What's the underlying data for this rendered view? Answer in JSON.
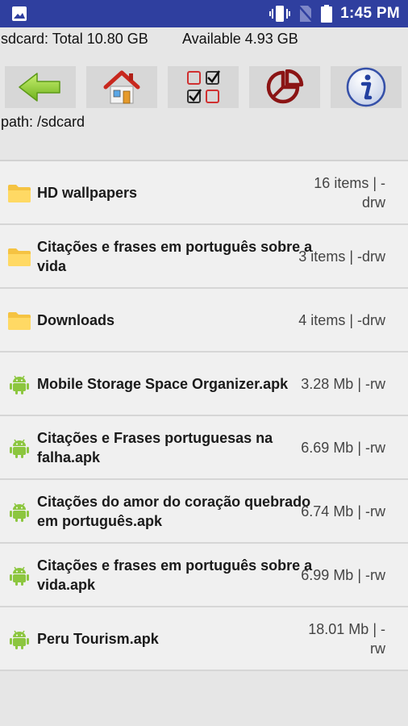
{
  "status_bar": {
    "time": "1:45 PM",
    "icons": [
      "image-icon",
      "vibrate-icon",
      "no-sim-icon",
      "battery-icon"
    ],
    "color": "#2f3f9f"
  },
  "storage": {
    "total": "sdcard: Total 10.80 GB",
    "available": "Available 4.93 GB"
  },
  "toolbar": {
    "buttons": [
      {
        "name": "back",
        "icon": "back-arrow-icon"
      },
      {
        "name": "home",
        "icon": "home-icon"
      },
      {
        "name": "select",
        "icon": "checklist-icon"
      },
      {
        "name": "storage-chart",
        "icon": "pie-chart-icon"
      },
      {
        "name": "info",
        "icon": "info-icon"
      }
    ]
  },
  "path": "path: /sdcard",
  "files": [
    {
      "type": "folder",
      "icon": "folder-icon",
      "name": "HD wallpapers",
      "meta": "16 items | -drw"
    },
    {
      "type": "folder",
      "icon": "folder-icon",
      "name": "Citações e frases em português sobre a vida",
      "meta": "3 items | -drw"
    },
    {
      "type": "folder",
      "icon": "folder-icon",
      "name": "Downloads",
      "meta": "4 items | -drw"
    },
    {
      "type": "apk",
      "icon": "android-icon",
      "name": "Mobile Storage Space Organizer.apk",
      "meta": "3.28 Mb  | -rw"
    },
    {
      "type": "apk",
      "icon": "android-icon",
      "name": "Citações e Frases portuguesas na falha.apk",
      "meta": "6.69 Mb  | -rw"
    },
    {
      "type": "apk",
      "icon": "android-icon",
      "name": "Citações do amor do coração quebrado em português.apk",
      "meta": "6.74 Mb  | -rw"
    },
    {
      "type": "apk",
      "icon": "android-icon",
      "name": "Citações e frases em português sobre a vida.apk",
      "meta": "6.99 Mb  | -rw"
    },
    {
      "type": "apk",
      "icon": "android-icon",
      "name": "Peru Tourism.apk",
      "meta": "18.01 Mb | -rw"
    }
  ]
}
